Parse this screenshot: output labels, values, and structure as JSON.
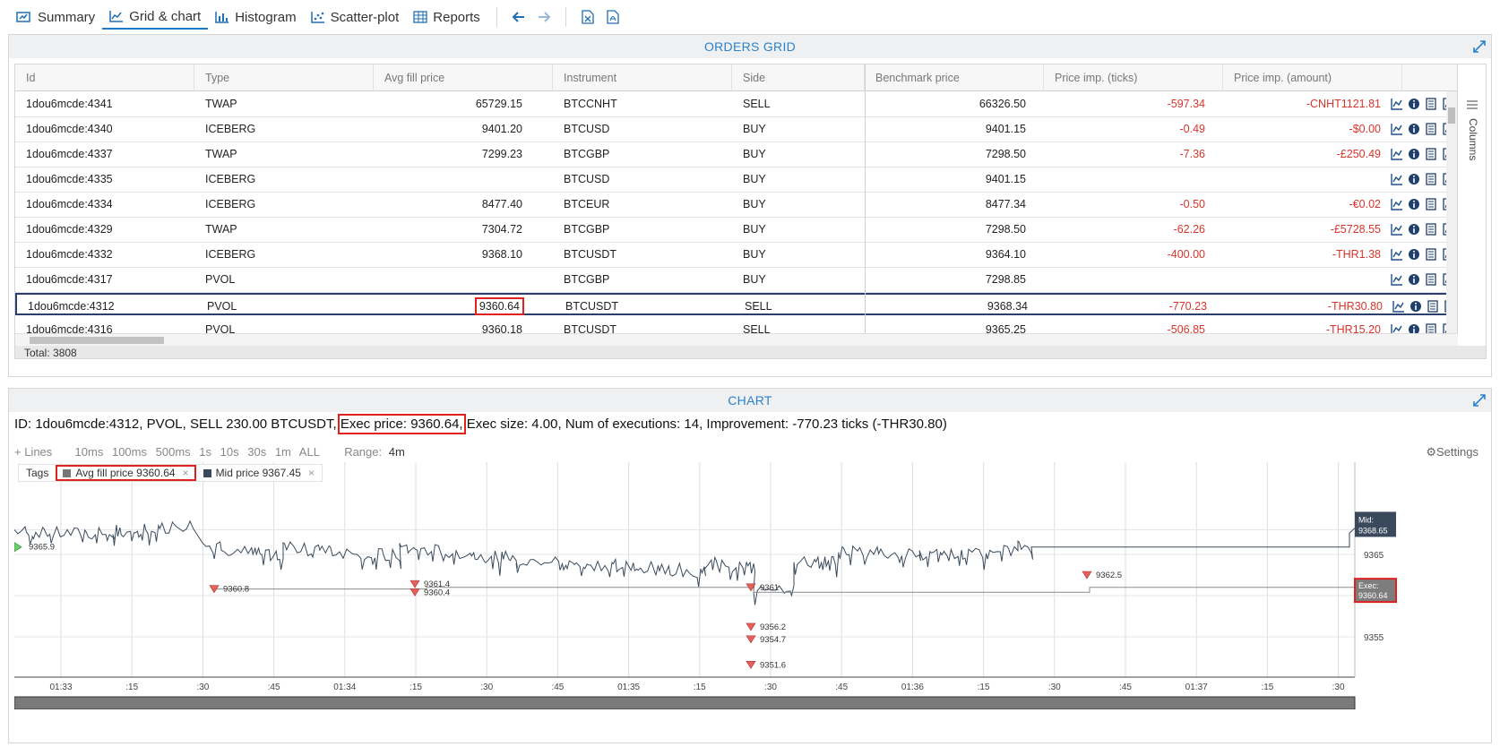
{
  "toolbar": {
    "tabs": [
      {
        "label": "Summary",
        "icon": "summary-icon"
      },
      {
        "label": "Grid & chart",
        "icon": "line-chart-icon"
      },
      {
        "label": "Histogram",
        "icon": "histogram-icon"
      },
      {
        "label": "Scatter-plot",
        "icon": "scatter-icon"
      },
      {
        "label": "Reports",
        "icon": "table-icon"
      }
    ],
    "active_tab": "Grid & chart",
    "nav_icons": [
      "arrow-left-icon",
      "arrow-right-icon"
    ],
    "export_icons": [
      "excel-export-icon",
      "pdf-export-icon"
    ]
  },
  "grid": {
    "title": "ORDERS GRID",
    "columns": [
      "Id",
      "Type",
      "Avg fill price",
      "Instrument",
      "Side",
      "Benchmark price",
      "Price imp. (ticks)",
      "Price imp. (amount)"
    ],
    "columns_tab_label": "Columns",
    "rows": [
      {
        "id": "1dou6mcde:4341",
        "type": "TWAP",
        "avg": "65729.15",
        "instrument": "BTCCNHT",
        "side": "SELL",
        "bench": "66326.50",
        "ticks": "-597.34",
        "amount": "-CNHT1121.81"
      },
      {
        "id": "1dou6mcde:4340",
        "type": "ICEBERG",
        "avg": "9401.20",
        "instrument": "BTCUSD",
        "side": "BUY",
        "bench": "9401.15",
        "ticks": "-0.49",
        "amount": "-$0.00"
      },
      {
        "id": "1dou6mcde:4337",
        "type": "TWAP",
        "avg": "7299.23",
        "instrument": "BTCGBP",
        "side": "BUY",
        "bench": "7298.50",
        "ticks": "-7.36",
        "amount": "-£250.49"
      },
      {
        "id": "1dou6mcde:4335",
        "type": "ICEBERG",
        "avg": "",
        "instrument": "BTCUSD",
        "side": "BUY",
        "bench": "9401.15",
        "ticks": "",
        "amount": ""
      },
      {
        "id": "1dou6mcde:4334",
        "type": "ICEBERG",
        "avg": "8477.40",
        "instrument": "BTCEUR",
        "side": "BUY",
        "bench": "8477.34",
        "ticks": "-0.50",
        "amount": "-€0.02"
      },
      {
        "id": "1dou6mcde:4329",
        "type": "TWAP",
        "avg": "7304.72",
        "instrument": "BTCGBP",
        "side": "BUY",
        "bench": "7298.50",
        "ticks": "-62.26",
        "amount": "-£5728.55"
      },
      {
        "id": "1dou6mcde:4332",
        "type": "ICEBERG",
        "avg": "9368.10",
        "instrument": "BTCUSDT",
        "side": "BUY",
        "bench": "9364.10",
        "ticks": "-400.00",
        "amount": "-THR1.38"
      },
      {
        "id": "1dou6mcde:4317",
        "type": "PVOL",
        "avg": "",
        "instrument": "BTCGBP",
        "side": "BUY",
        "bench": "7298.85",
        "ticks": "",
        "amount": ""
      },
      {
        "id": "1dou6mcde:4312",
        "type": "PVOL",
        "avg": "9360.64",
        "instrument": "BTCUSDT",
        "side": "SELL",
        "bench": "9368.34",
        "ticks": "-770.23",
        "amount": "-THR30.80"
      },
      {
        "id": "1dou6mcde:4316",
        "type": "PVOL",
        "avg": "9360.18",
        "instrument": "BTCUSDT",
        "side": "SELL",
        "bench": "9365.25",
        "ticks": "-506.85",
        "amount": "-THR15.20"
      }
    ],
    "selected_row_index": 8,
    "row_action_icons": [
      "chart-icon",
      "info-icon",
      "document-icon",
      "pdf-icon"
    ],
    "footer": "Total: 3808"
  },
  "chart": {
    "title": "CHART",
    "info": {
      "prefix": "ID:  1dou6mcde:4312,  PVOL,  SELL  230.00  BTCUSDT,",
      "exec_price": "Exec price:  9360.64,",
      "rest": "Exec size:  4.00,  Num of executions:  14,  Improvement:  -770.23  ticks  (-THR30.80)"
    },
    "controls": {
      "lines": "+ Lines",
      "intervals": [
        "10ms",
        "100ms",
        "500ms",
        "1s",
        "10s",
        "30s",
        "1m",
        "ALL"
      ],
      "range_label": "Range:",
      "range_value": "4m",
      "settings": "Settings"
    },
    "tags": {
      "label": "Tags",
      "items": [
        {
          "label": "Avg fill price  9360.64",
          "color": "#777777"
        },
        {
          "label": "Mid price  9367.45",
          "color": "#3a4a5c"
        }
      ]
    },
    "x_ticks": [
      "01:33",
      ":15",
      ":30",
      ":45",
      "01:34",
      ":15",
      ":30",
      ":45",
      "01:35",
      ":15",
      ":30",
      ":45",
      "01:36",
      ":15",
      ":30",
      ":45",
      "01:37",
      ":15",
      ":30"
    ],
    "y_ticks": [
      "9365",
      "9355"
    ],
    "markers": [
      {
        "label": "9365.9"
      },
      {
        "label": "9360.8"
      },
      {
        "label": "9361.4"
      },
      {
        "label": "9360.4"
      },
      {
        "label": "9361"
      },
      {
        "label": "9362.5"
      },
      {
        "label": "9356.2"
      },
      {
        "label": "9354.7"
      },
      {
        "label": "9351.6"
      }
    ],
    "mid_badge": {
      "line1": "Mid:",
      "line2": "9368.65"
    },
    "exec_badge": {
      "line1": "Exec:",
      "line2": "9360.64"
    },
    "colors": {
      "mid_line": "#3a4a5c",
      "exec_line": "#8a8a8a",
      "marker": "#e8605a",
      "accent": "#2c82c9",
      "highlight": "#e0221f"
    }
  }
}
